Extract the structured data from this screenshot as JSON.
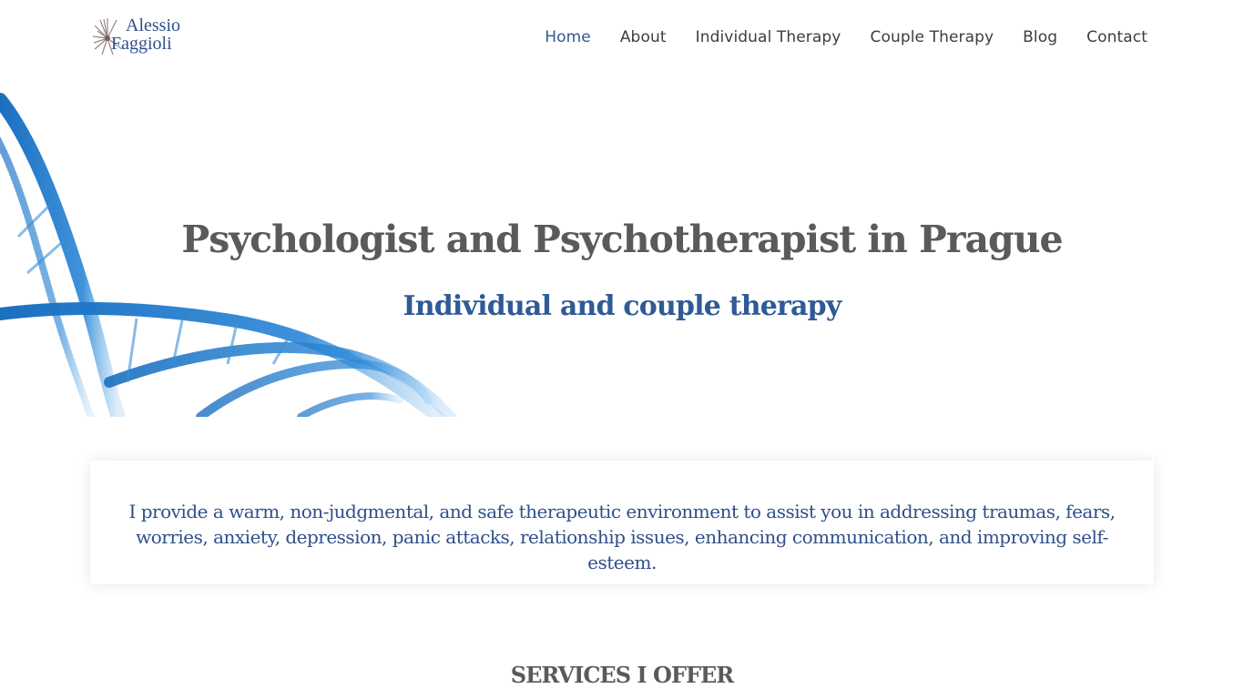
{
  "brand": {
    "line1": "Alessio",
    "line2": "Faggioli",
    "logo_icon": "feather-flower-icon",
    "accent_color": "#2f5a95",
    "text_color": "#3d3d3d"
  },
  "nav": {
    "items": [
      {
        "label": "Home",
        "active": true
      },
      {
        "label": "About",
        "active": false
      },
      {
        "label": "Individual Therapy",
        "active": false
      },
      {
        "label": "Couple Therapy",
        "active": false
      },
      {
        "label": "Blog",
        "active": false
      },
      {
        "label": "Contact",
        "active": false
      }
    ]
  },
  "hero": {
    "title": "Psychologist and Psychotherapist in Prague",
    "subtitle": "Individual and couple therapy",
    "image": "dna-helix-illustration"
  },
  "intro": {
    "text": "I provide a warm, non-judgmental, and safe therapeutic environment to assist you in addressing traumas, fears, worries, anxiety, depression, panic attacks, relationship issues, enhancing communication, and improving self-esteem."
  },
  "services": {
    "heading": "SERVICES I OFFER"
  }
}
